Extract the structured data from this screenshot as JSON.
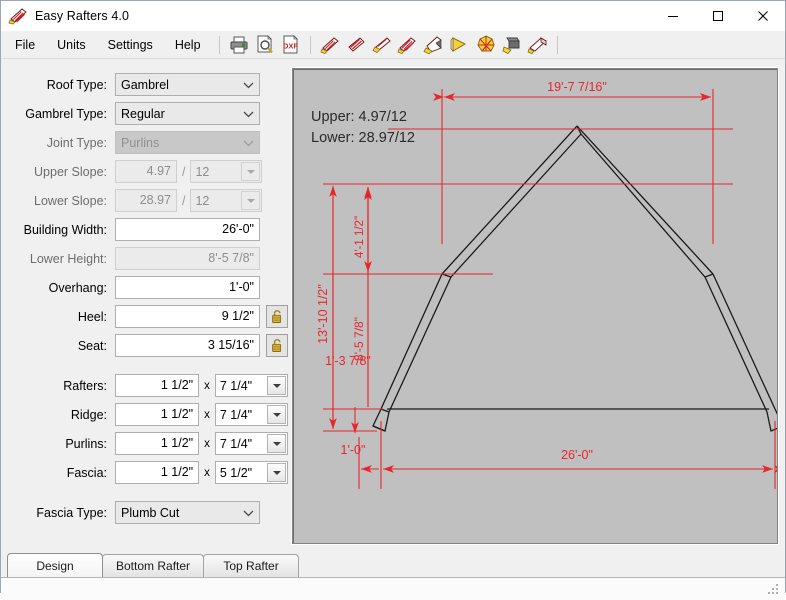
{
  "window": {
    "title": "Easy Rafters 4.0",
    "app_icon": "rafter-icon",
    "minimize_label": "─",
    "maximize_label": "□",
    "close_label": "✕"
  },
  "menubar": {
    "items": [
      {
        "label": "File",
        "name": "menu-file"
      },
      {
        "label": "Units",
        "name": "menu-units"
      },
      {
        "label": "Settings",
        "name": "menu-settings"
      },
      {
        "label": "Help",
        "name": "menu-help"
      }
    ],
    "toolbar": [
      {
        "name": "print-icon",
        "title": "Print"
      },
      {
        "name": "print-preview-icon",
        "title": "Print Preview"
      },
      {
        "name": "dxf-export-icon",
        "title": "DXF",
        "label": "DXF"
      },
      {
        "name": "common-rafter-icon",
        "title": "Common Rafter"
      },
      {
        "name": "hip-rafter-icon",
        "title": "Hip Rafter"
      },
      {
        "name": "valley-rafter-icon",
        "title": "Valley Rafter"
      },
      {
        "name": "jack-rafter-icon",
        "title": "Jack Rafter"
      },
      {
        "name": "birdsmouth-icon",
        "title": "Birdsmouth"
      },
      {
        "name": "bevel-icon",
        "title": "Bevel"
      },
      {
        "name": "polygon-roof-icon",
        "title": "Polygon Roof"
      },
      {
        "name": "ridge-icon",
        "title": "Ridge"
      },
      {
        "name": "fascia-icon",
        "title": "Fascia"
      }
    ]
  },
  "form": {
    "roof_type": {
      "label": "Roof Type:",
      "value": "Gambrel",
      "disabled": false
    },
    "gambrel_type": {
      "label": "Gambrel Type:",
      "value": "Regular",
      "disabled": false
    },
    "joint_type": {
      "label": "Joint Type:",
      "value": "Purlins",
      "disabled": true
    },
    "upper_slope": {
      "label": "Upper Slope:",
      "rise": "4.97",
      "separator": "/",
      "run": "12",
      "disabled": true
    },
    "lower_slope": {
      "label": "Lower Slope:",
      "rise": "28.97",
      "separator": "/",
      "run": "12",
      "disabled": true
    },
    "building_width": {
      "label": "Building Width:",
      "value": "26'-0\"",
      "disabled": false
    },
    "lower_height": {
      "label": "Lower Height:",
      "value": "8'-5 7/8\"",
      "disabled": true
    },
    "overhang": {
      "label": "Overhang:",
      "value": "1'-0\"",
      "disabled": false
    },
    "heel": {
      "label": "Heel:",
      "value": "9 1/2\"",
      "disabled": false,
      "lock": "unlocked-padlock-icon"
    },
    "seat": {
      "label": "Seat:",
      "value": "3 15/16\"",
      "disabled": false,
      "lock": "unlocked-padlock-icon"
    },
    "rafters": {
      "label": "Rafters:",
      "thickness": "1 1/2\"",
      "x": "x",
      "depth": "7 1/4\""
    },
    "ridge": {
      "label": "Ridge:",
      "thickness": "1 1/2\"",
      "x": "x",
      "depth": "7 1/4\""
    },
    "purlins": {
      "label": "Purlins:",
      "thickness": "1 1/2\"",
      "x": "x",
      "depth": "7 1/4\""
    },
    "fascia": {
      "label": "Fascia:",
      "thickness": "1 1/2\"",
      "x": "x",
      "depth": "5 1/2\""
    },
    "fascia_type": {
      "label": "Fascia Type:",
      "value": "Plumb Cut",
      "disabled": false
    }
  },
  "drawing": {
    "slope_upper_text": "Upper: 4.97/12",
    "slope_lower_text": "Lower: 28.97/12",
    "dim_color": "#e8262a",
    "outline_color": "#1a1a1a",
    "background": "#c0c0c0",
    "dimensions": {
      "top_span": "19'-7 7/16\"",
      "upper_rise": "4'-1 1/2\"",
      "total_height": "13'-10 1/2\"",
      "lower_height": "8'-5 7/8\"",
      "heel_height": "1'-3 7/8\"",
      "overhang": "1'-0\"",
      "building_width": "26'-0\""
    }
  },
  "tabs": [
    {
      "label": "Design",
      "active": true
    },
    {
      "label": "Bottom Rafter",
      "active": false
    },
    {
      "label": "Top Rafter",
      "active": false
    }
  ]
}
